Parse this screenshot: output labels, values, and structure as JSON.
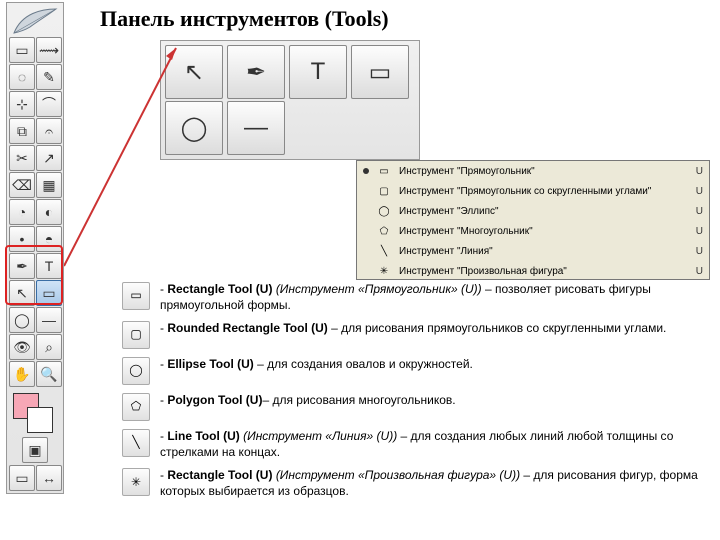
{
  "title": "Панель инструментов (Tools)",
  "toolbar_icons": [
    "▭",
    "⟿",
    "◌",
    "✎",
    "⊹",
    "⌒",
    "⧉",
    "𝄐",
    "✂",
    "↗",
    "⌫",
    "▦",
    "◔",
    "◐",
    "•",
    "◓",
    "✒",
    "T",
    "↖",
    "▭",
    "◯",
    "—",
    "👁",
    "⌕",
    "✋",
    "🔍"
  ],
  "swatch": {
    "fg": "#f7a7b6",
    "bg": "#ffffff"
  },
  "bigtools_icons": [
    "↖",
    "✒",
    "T",
    "▭",
    "◯",
    "—"
  ],
  "submenu": [
    {
      "sel": true,
      "icon": "▭",
      "label": "Инструмент \"Прямоугольник\"",
      "key": "U"
    },
    {
      "sel": false,
      "icon": "▢",
      "label": "Инструмент \"Прямоугольник со скругленными углами\"",
      "key": "U"
    },
    {
      "sel": false,
      "icon": "◯",
      "label": "Инструмент \"Эллипс\"",
      "key": "U"
    },
    {
      "sel": false,
      "icon": "⬠",
      "label": "Инструмент \"Многоугольник\"",
      "key": "U"
    },
    {
      "sel": false,
      "icon": "╲",
      "label": "Инструмент \"Линия\"",
      "key": "U"
    },
    {
      "sel": false,
      "icon": "✳",
      "label": "Инструмент \"Произвольная фигура\"",
      "key": "U"
    }
  ],
  "descriptions": [
    {
      "icon": "▭",
      "html": "- <b>Rectangle Tool (U)</b> <i>(Инструмент «Прямоугольник» (U))</i> – позволяет рисовать фигуры прямоугольной формы."
    },
    {
      "icon": "▢",
      "html": "- <b>Rounded Rectangle Tool (U)</b> – для рисования прямоугольников со скругленными углами."
    },
    {
      "icon": "◯",
      "html": "- <b>Ellipse Tool (U)</b> – для создания овалов и окружностей."
    },
    {
      "icon": "⬠",
      "html": "- <b>Polygon Tool (U)</b>– для рисования многоугольников."
    },
    {
      "icon": "╲",
      "html": "- <b>Line Tool (U)</b> <i>(Инструмент «Линия» (U))</i> – для создания любых линий любой толщины со стрелками на концах."
    },
    {
      "icon": "✳",
      "html": "- <b>Rectangle Tool (U)</b> <i>(Инструмент «Произвольная фигура» (U))</i> – для рисования фигур, форма которых выбирается из образцов."
    }
  ]
}
